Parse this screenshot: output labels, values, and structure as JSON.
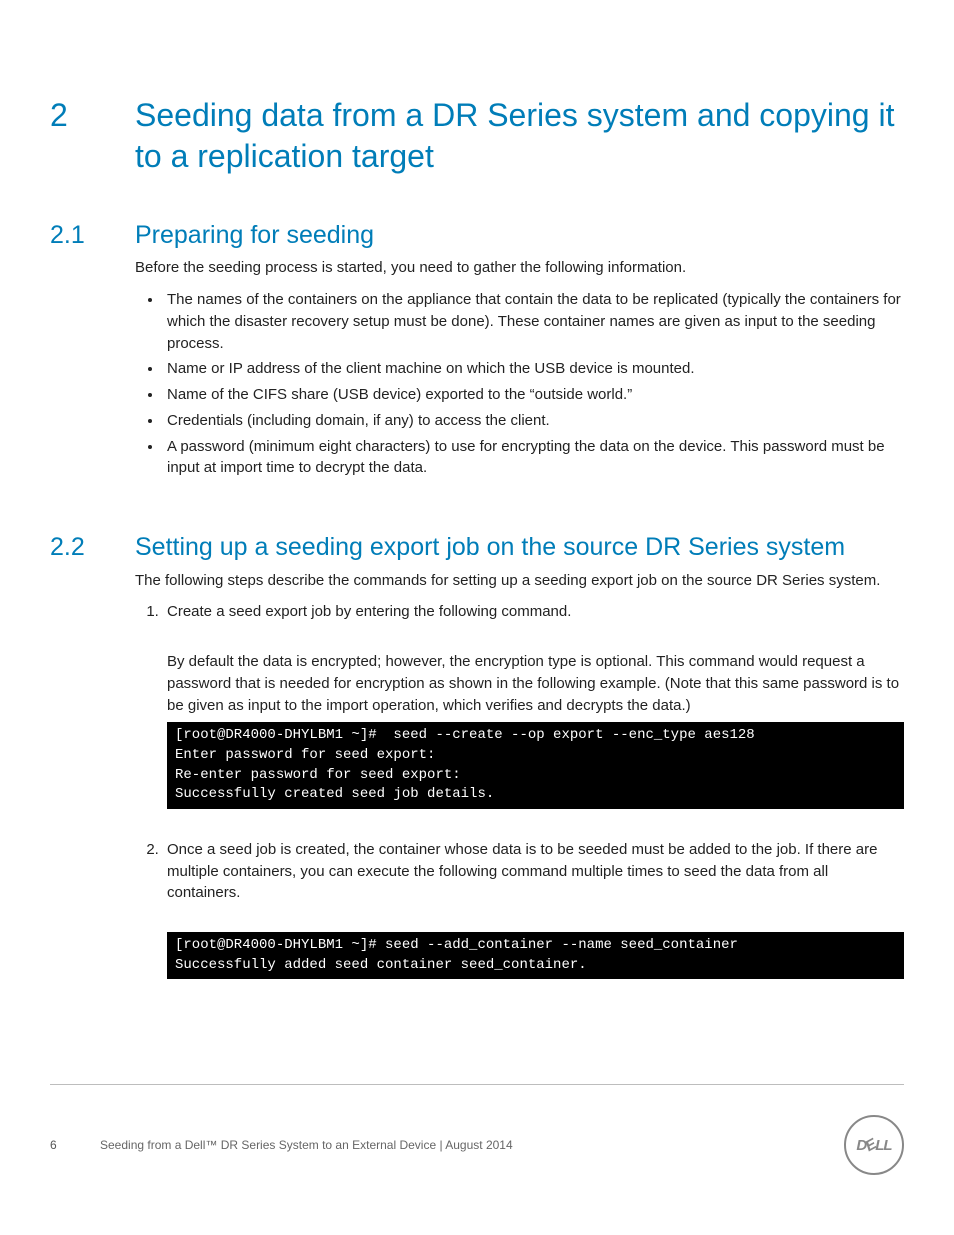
{
  "section": {
    "number": "2",
    "title": "Seeding data from a DR Series system and copying it to a replication target"
  },
  "sub1": {
    "number": "2.1",
    "title": "Preparing for seeding",
    "intro": "Before the seeding process is started, you need to gather the following information.",
    "bullets": [
      "The names of the containers on the appliance that contain the data to be replicated (typically the containers for which the disaster recovery setup must be done). These container names are given as input to the seeding process.",
      "Name or IP address of the client machine on which the USB device is mounted.",
      "Name of the CIFS share (USB device) exported to the “outside world.”",
      "Credentials (including domain, if any) to access the client.",
      "A password (minimum eight characters) to use for encrypting the data on the device. This password must be input at import time to decrypt the data."
    ]
  },
  "sub2": {
    "number": "2.2",
    "title": "Setting up a seeding export job on the source DR Series system",
    "intro": "The following steps describe the commands for setting up a seeding export job on the source DR Series system.",
    "steps": {
      "s1": {
        "lead": "Create a seed export job by entering the following command.",
        "para": "By default the data is encrypted; however, the encryption type is optional. This command would request a password that is needed for encryption as shown in the following example. (Note that this same password is to be given as input to the import operation, which verifies and decrypts the data.)",
        "term": "[root@DR4000-DHYLBM1 ~]#  seed --create --op export --enc_type aes128\nEnter password for seed export:\nRe-enter password for seed export:\nSuccessfully created seed job details."
      },
      "s2": {
        "lead": "Once a seed job is created, the container whose data is to be seeded must be added to the job. If there are multiple containers, you can execute the following command multiple times to seed the data from all containers.",
        "term": "[root@DR4000-DHYLBM1 ~]# seed --add_container --name seed_container\nSuccessfully added seed container seed_container."
      }
    }
  },
  "footer": {
    "page": "6",
    "title": "Seeding from a Dell™ DR Series System to an External Device | August 2014",
    "logo_text": "DELL"
  }
}
